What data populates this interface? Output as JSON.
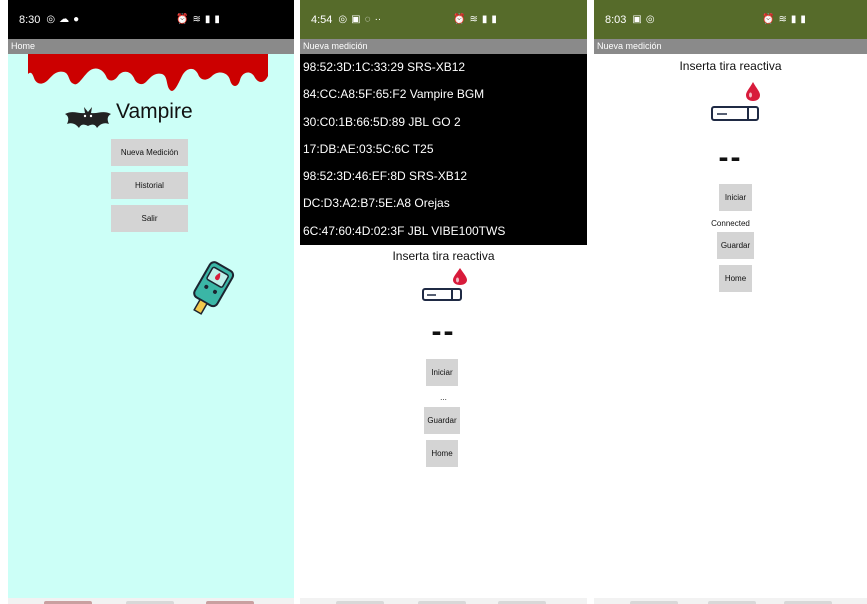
{
  "phone1": {
    "status": {
      "time": "8:30"
    },
    "title": "Home",
    "app_name": "Vampire",
    "buttons": {
      "new": "Nueva Medición",
      "history": "Historial",
      "exit": "Salir"
    }
  },
  "phone2": {
    "status": {
      "time": "4:54"
    },
    "title": "Nueva medición",
    "devices": [
      "98:52:3D:1C:33:29 SRS-XB12",
      "84:CC:A8:5F:65:F2 Vampire BGM",
      "30:C0:1B:66:5D:89 JBL GO 2",
      "17:DB:AE:03:5C:6C T25",
      "98:52:3D:46:EF:8D SRS-XB12",
      "DC:D3:A2:B7:5E:A8 Orejas",
      "6C:47:60:4D:02:3F JBL VIBE100TWS"
    ],
    "heading": "Inserta tira reactiva",
    "reading": "--",
    "buttons": {
      "start": "Iniciar",
      "save": "Guardar",
      "home": "Home"
    },
    "connection_status": "..."
  },
  "phone3": {
    "status": {
      "time": "8:03"
    },
    "title": "Nueva medición",
    "heading": "Inserta tira reactiva",
    "reading": "--",
    "buttons": {
      "start": "Iniciar",
      "save": "Guardar",
      "home": "Home"
    },
    "connection_status": "Connected"
  },
  "colors": {
    "home_background": "#ccfff7",
    "blood_red": "#cc0000",
    "status_green": "#566b2a",
    "button_gray": "#d4d4d4",
    "drop_red": "#d81b3b",
    "strip_navy": "#1f2a44"
  },
  "icons": {
    "status": [
      "settings-icon",
      "cloud-icon",
      "alarm-icon",
      "wifi-icon",
      "signal-icon",
      "battery-icon"
    ],
    "home": [
      "bat-icon",
      "glucometer-icon",
      "blood-drip"
    ],
    "measure": [
      "blood-drop-icon",
      "test-strip-icon"
    ]
  }
}
